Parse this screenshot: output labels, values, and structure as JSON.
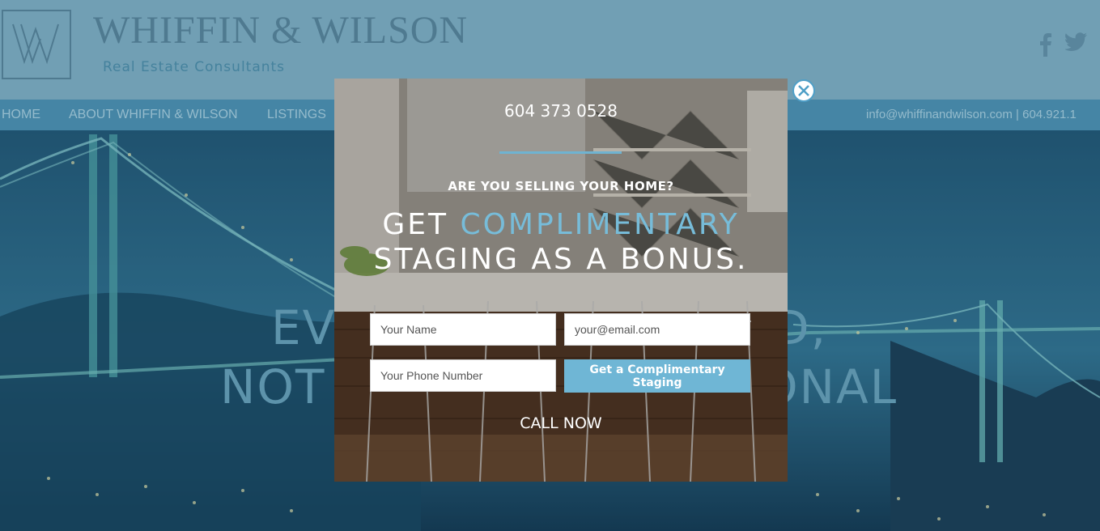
{
  "site": {
    "brand": "WHIFFIN & WILSON",
    "tagline": "Real Estate Consultants",
    "logo_mark": "W",
    "social_icons": [
      "facebook-icon",
      "twitter-icon"
    ]
  },
  "nav": {
    "items": [
      {
        "label": "HOME"
      },
      {
        "label": "ABOUT WHIFFIN & WILSON"
      },
      {
        "label": "LISTINGS"
      }
    ],
    "contact": "info@whiffinandwilson.com  |  604.921.1"
  },
  "hero": {
    "line1_left": "EV",
    "line1_right": "D,",
    "line2_left": "NOT",
    "line2_right": "ONAL"
  },
  "modal": {
    "phone": "604 373 0528",
    "question": "ARE YOU SELLING YOUR HOME?",
    "headline_get": "GET ",
    "headline_accent": "COMPLIMENTARY",
    "headline_line2": "STAGING AS A BONUS.",
    "name_placeholder": "Your Name",
    "email_placeholder": "your@email.com",
    "phone_placeholder": "Your Phone Number",
    "submit_label": "Get a Complimentary Staging",
    "call_now": "CALL NOW",
    "close_icon": "close-icon"
  },
  "colors": {
    "accent": "#6fb6d5",
    "header_bg": "#8ab6c8",
    "nav_bg": "#4f93b4"
  }
}
